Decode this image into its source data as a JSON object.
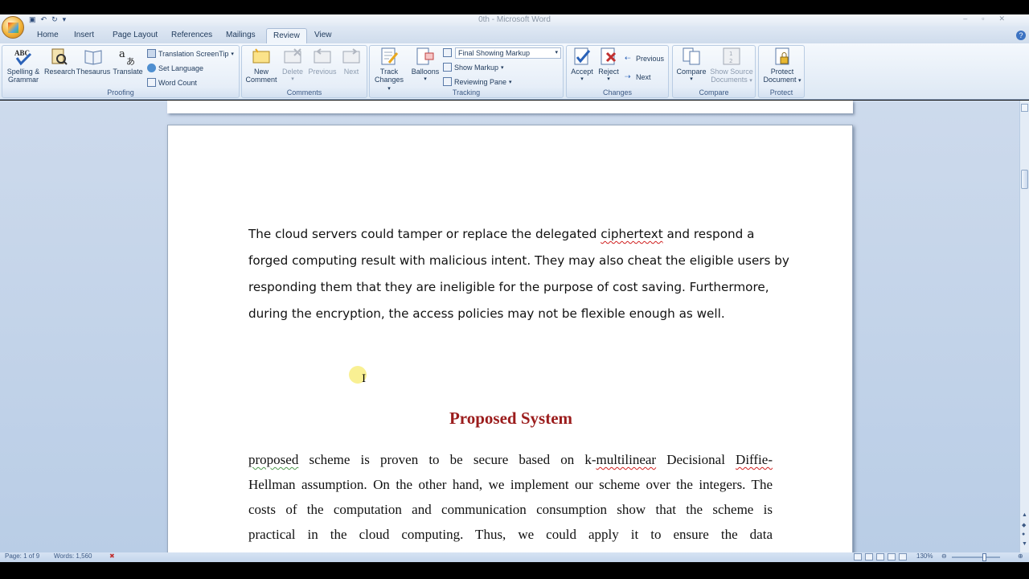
{
  "window": {
    "title": "0th - Microsoft Word"
  },
  "tabs": [
    {
      "label": "Home"
    },
    {
      "label": "Insert"
    },
    {
      "label": "Page Layout"
    },
    {
      "label": "References"
    },
    {
      "label": "Mailings"
    },
    {
      "label": "Review",
      "active": true
    },
    {
      "label": "View"
    }
  ],
  "ribbon": {
    "proofing": {
      "label": "Proofing",
      "spelling": "Spelling &",
      "spelling2": "Grammar",
      "research": "Research",
      "thesaurus": "Thesaurus",
      "translate": "Translate",
      "translation_screentip": "Translation ScreenTip",
      "set_language": "Set Language",
      "word_count": "Word Count"
    },
    "comments": {
      "label": "Comments",
      "new_comment": "New",
      "new_comment2": "Comment",
      "delete": "Delete",
      "previous": "Previous",
      "next": "Next"
    },
    "tracking": {
      "label": "Tracking",
      "track_changes": "Track",
      "track_changes2": "Changes",
      "balloons": "Balloons",
      "markup_select": "Final Showing Markup",
      "show_markup": "Show Markup",
      "reviewing_pane": "Reviewing Pane"
    },
    "changes": {
      "label": "Changes",
      "accept": "Accept",
      "reject": "Reject",
      "previous": "Previous",
      "next": "Next"
    },
    "compare": {
      "label": "Compare",
      "compare": "Compare",
      "show_source": "Show Source",
      "show_source2": "Documents"
    },
    "protect": {
      "label": "Protect",
      "protect_document": "Protect",
      "protect_document2": "Document"
    }
  },
  "document": {
    "para1_lines": [
      "The cloud servers could tamper or replace the delegated ",
      "ciphertext",
      " and respond a",
      "forged computing result with malicious intent. They may also cheat the eligible users by",
      "responding them that they are ineligible for the purpose of cost saving. Furthermore,",
      "during the encryption, the access policies may not be flexible enough as well."
    ],
    "heading": "Proposed System",
    "para2": {
      "l1a": "proposed",
      "l1b": " scheme is proven to be secure based on k-",
      "l1c": "multilinear",
      "l1d": " Decisional ",
      "l1e": "Diffie-",
      "l2": "Hellman assumption. On the other hand, we implement our scheme over the integers. The",
      "l3": "costs of the computation and communication consumption show that the scheme is",
      "l4": "practical in the cloud computing. Thus, we could apply it to ensure the data"
    }
  },
  "status": {
    "page": "Page: 1 of 9",
    "words": "Words: 1,560",
    "zoom": "130%"
  }
}
